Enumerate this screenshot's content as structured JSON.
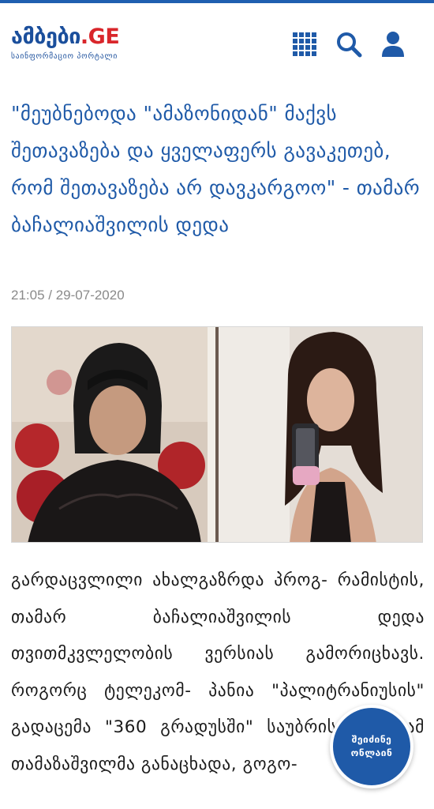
{
  "header": {
    "logo_text": "ამბები",
    "logo_tld": ".GE",
    "tagline": "საინფორმაციო პორტალი",
    "icons": [
      "grid-menu-icon",
      "search-icon",
      "user-icon"
    ]
  },
  "article": {
    "title": "\"მეუბნებოდა \"ამაზონიდან\" მაქვს შეთავაზება და ყველაფერს გავაკეთებ, რომ შეთავაზება არ დავკარგოო\" - თამარ ბაჩალიაშვილის დედა",
    "date": "21:05 / 29-07-2020",
    "body": "გარდაცვლილი ახალგაზრდა პროგ- რამისტის, თამარ ბაჩალიაშვილის დედა თვითმკვლელობის ვერსიას გამორიცხავს. როგორც ტელეკომ- პანია \"პალიტრანიუსის\" გადაცემა \"360 გრადუსში\" საუბრისას დედამ თამაზაშვილმა განაცხადა, გოგო-"
  },
  "live_button": {
    "line1": "შეიძინე",
    "line2": "ონლაინ"
  },
  "colors": {
    "brand_blue": "#1f5aa8",
    "logo_red": "#d9262b",
    "date_gray": "#8a8a8a"
  }
}
